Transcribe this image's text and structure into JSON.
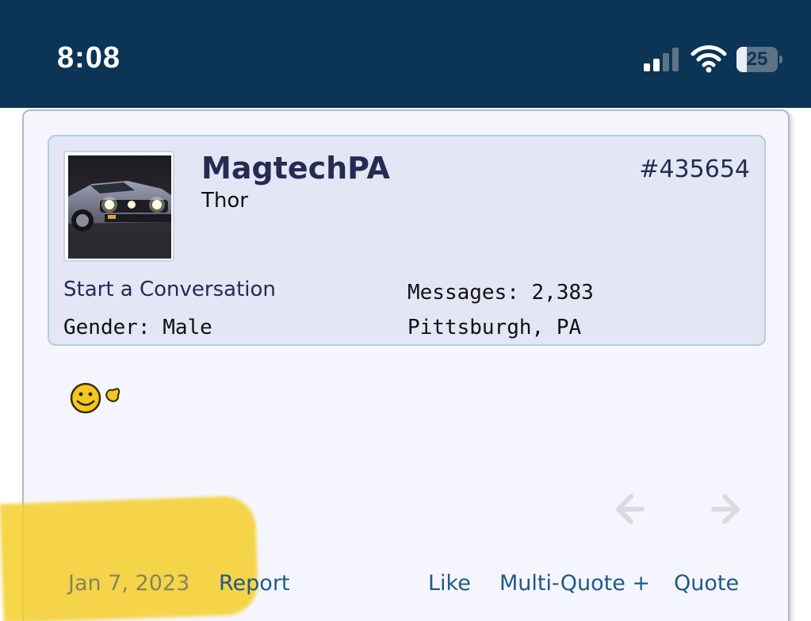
{
  "status_bar": {
    "time": "8:08",
    "battery_level": "25",
    "battery_fraction": 0.25,
    "signal_bars_active": 2,
    "signal_bars_total": 4,
    "background_color": "#0c3454"
  },
  "post": {
    "username": "MagtechPA",
    "user_title": "Thor",
    "post_number": "#435654",
    "start_conversation": "Start a Conversation",
    "messages": "Messages: 2,383",
    "gender": "Gender: Male",
    "location": "Pittsburgh, PA",
    "avatar_icon": "mustang-car-avatar",
    "body_icon": "smiley-waving-icon",
    "date": "Jan 7, 2023",
    "report_label": "Report",
    "like_label": "Like",
    "multiquote_label": "Multi-Quote +",
    "quote_label": "Quote"
  },
  "colors": {
    "link": "#205a86",
    "username": "#272a52",
    "highlight": "#f5cf2a",
    "card_background": "#f5f6fd",
    "user_block_background": "#e3e6f4"
  }
}
